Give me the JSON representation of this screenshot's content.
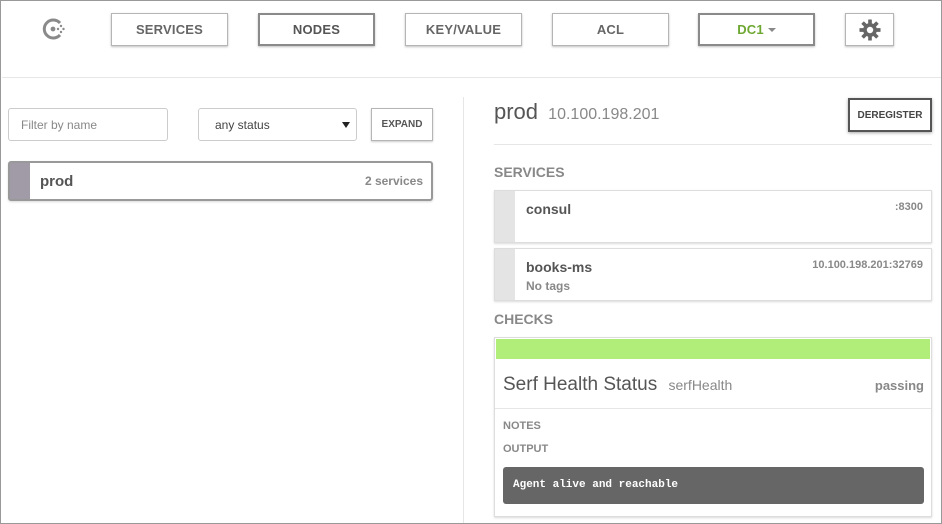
{
  "nav": {
    "services": "SERVICES",
    "nodes": "NODES",
    "kv": "KEY/VALUE",
    "acl": "ACL",
    "datacenter": "DC1"
  },
  "filters": {
    "name_placeholder": "Filter by name",
    "status_value": "any status",
    "expand_label": "EXPAND"
  },
  "node_list": [
    {
      "name": "prod",
      "services": "2 services"
    }
  ],
  "detail": {
    "name": "prod",
    "address": "10.100.198.201",
    "deregister_label": "DEREGISTER",
    "services_heading": "SERVICES",
    "services": [
      {
        "name": "consul",
        "port": ":8300",
        "tags": ""
      },
      {
        "name": "books-ms",
        "port": "10.100.198.201:32769",
        "tags": "No tags"
      }
    ],
    "checks_heading": "CHECKS",
    "check": {
      "name": "Serf Health Status",
      "id": "serfHealth",
      "status": "passing",
      "notes_label": "NOTES",
      "output_label": "OUTPUT",
      "output": "Agent alive and reachable"
    }
  },
  "colors": {
    "passing": "#b1ed79",
    "node_stripe": "#a09ba6",
    "dc_text": "#6ea832"
  },
  "icons": {
    "logo": "consul-logo-icon",
    "settings": "gear-icon",
    "dropdown": "chevron-down-icon"
  }
}
